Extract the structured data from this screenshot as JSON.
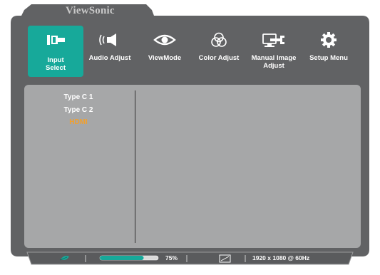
{
  "brand": "ViewSonic",
  "colors": {
    "accent": "#17a99a",
    "active_input": "#f0a030",
    "panel": "#a6a7a8",
    "frame": "#616264"
  },
  "menu": [
    {
      "label": "Input Select",
      "icon": "input-select-icon",
      "selected": true
    },
    {
      "label": "Audio Adjust",
      "icon": "speaker-icon",
      "selected": false
    },
    {
      "label": "ViewMode",
      "icon": "eye-icon",
      "selected": false
    },
    {
      "label": "Color Adjust",
      "icon": "color-circles-icon",
      "selected": false
    },
    {
      "label": "Manual Image Adjust",
      "icon": "monitor-wrench-icon",
      "selected": false
    },
    {
      "label": "Setup Menu",
      "icon": "gear-icon",
      "selected": false
    }
  ],
  "inputs": [
    {
      "label": "Type C 1",
      "active": false
    },
    {
      "label": "Type C 2",
      "active": false
    },
    {
      "label": "HDMI",
      "active": true
    }
  ],
  "status": {
    "eco_icon": "leaf-icon",
    "brightness_percent": 75,
    "brightness_label": "75%",
    "display_icon": "display-icon",
    "resolution": "1920 x 1080 @ 60Hz"
  }
}
